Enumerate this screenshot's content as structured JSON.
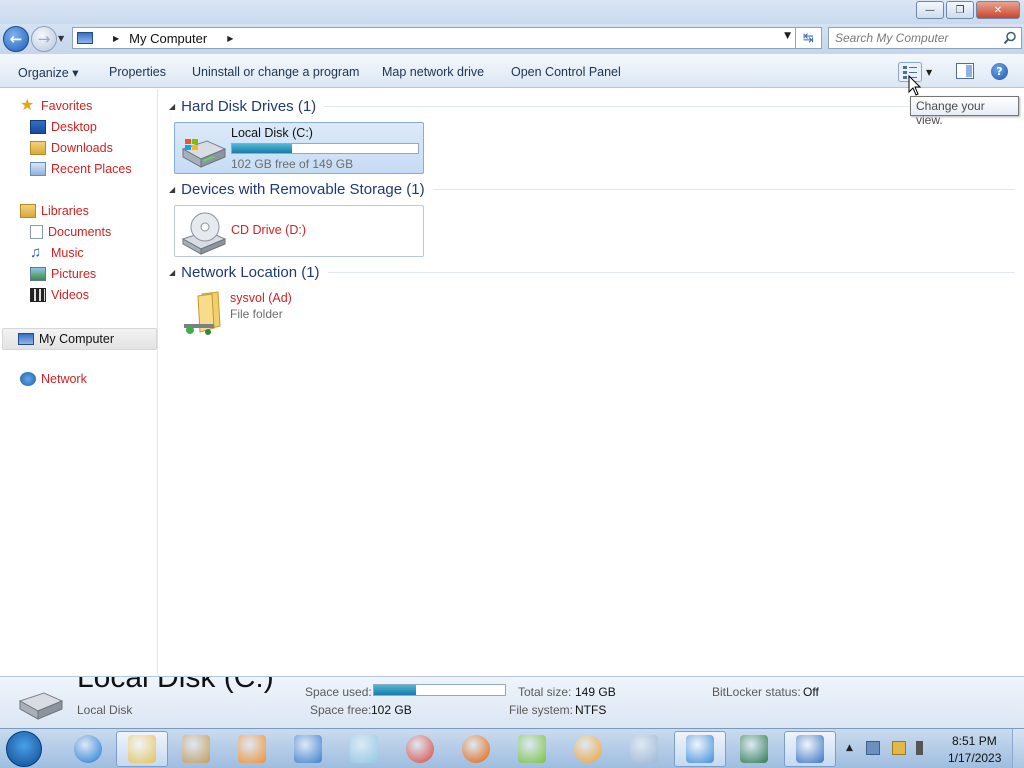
{
  "window": {
    "minimize_glyph": "—",
    "restore_glyph": "❐",
    "close_glyph": "✕"
  },
  "address": {
    "path": "My Computer",
    "search_placeholder": "Search My Computer"
  },
  "toolbar": {
    "organize": "Organize ▾",
    "properties": "Properties",
    "uninstall": "Uninstall or change a program",
    "map_drive": "Map network drive",
    "control_panel": "Open Control Panel",
    "help_glyph": "?"
  },
  "tooltip": "Change your view.",
  "nav": {
    "favorites": "Favorites",
    "desktop": "Desktop",
    "downloads": "Downloads",
    "recent_places": "Recent Places",
    "libraries": "Libraries",
    "documents": "Documents",
    "music": "Music",
    "pictures": "Pictures",
    "videos": "Videos",
    "my_computer": "My Computer",
    "network": "Network"
  },
  "groups": {
    "hard_disks": {
      "header": "Hard Disk Drives (1)",
      "item_name": "Local Disk (C:)",
      "item_free": "102 GB free of 149 GB",
      "used_fraction": 0.32
    },
    "removable": {
      "header": "Devices with Removable Storage (1)",
      "item_name": "CD Drive (D:)"
    },
    "network": {
      "header": "Network Location (1)",
      "item_name": "sysvol (Ad)",
      "item_type": "File folder"
    }
  },
  "details": {
    "title": "Local Disk (C:)",
    "type": "Local Disk",
    "space_used_label": "Space used:",
    "space_used_fraction": 0.32,
    "space_free_label": "Space free:",
    "space_free": "102 GB",
    "total_size_label": "Total size:",
    "total_size": "149 GB",
    "file_system_label": "File system:",
    "file_system": "NTFS",
    "bitlocker_label": "BitLocker status:",
    "bitlocker": "Off"
  },
  "taskbar": {
    "time": "8:51 PM",
    "date": "1/17/2023",
    "apps": [
      {
        "name": "internet-explorer",
        "color": "#1e78d6"
      },
      {
        "name": "windows-explorer",
        "color": "#e8c25a"
      },
      {
        "name": "paint",
        "color": "#c59c5a"
      },
      {
        "name": "media-player",
        "color": "#f09230"
      },
      {
        "name": "wordpad",
        "color": "#3f7fd1"
      },
      {
        "name": "notepad",
        "color": "#8fcbe6"
      },
      {
        "name": "chrome",
        "color": "#db4437"
      },
      {
        "name": "firefox",
        "color": "#e66000"
      },
      {
        "name": "notepad-plus-plus",
        "color": "#7cc242"
      },
      {
        "name": "security-app",
        "color": "#f2a22b"
      },
      {
        "name": "calculator",
        "color": "#9fb8d4"
      },
      {
        "name": "control-panel",
        "color": "#3f8fd9"
      },
      {
        "name": "remote-desktop",
        "color": "#2e7d4f"
      },
      {
        "name": "virtual-drive",
        "color": "#3a74c4"
      }
    ]
  }
}
